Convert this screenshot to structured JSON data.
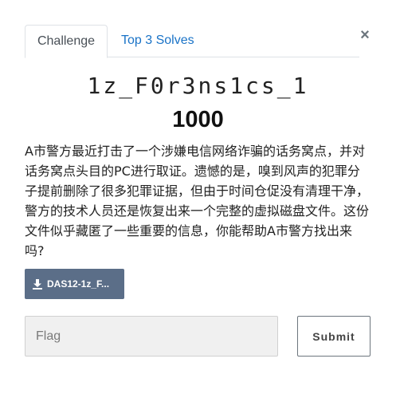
{
  "tabs": {
    "challenge": "Challenge",
    "top_solves": "Top 3 Solves"
  },
  "close_symbol": "×",
  "challenge": {
    "name": "1z_F0r3ns1cs_1",
    "points": "1000",
    "description": "A市警方最近打击了一个涉嫌电信网络诈骗的话务窝点，并对话务窝点头目的PC进行取证。遗憾的是，嗅到风声的犯罪分子提前删除了很多犯罪证据，但由于时间仓促没有清理干净，警方的技术人员还是恢复出来一个完整的虚拟磁盘文件。这份文件似乎藏匿了一些重要的信息，你能帮助A市警方找出来吗?",
    "file_label": "DAS12-1z_F..."
  },
  "form": {
    "flag_placeholder": "Flag",
    "submit_label": "Submit"
  },
  "colors": {
    "file_button_bg": "#5b6e88",
    "tab_link": "#1a73c7"
  },
  "icons": {
    "download": "download-icon",
    "close": "close-icon"
  }
}
